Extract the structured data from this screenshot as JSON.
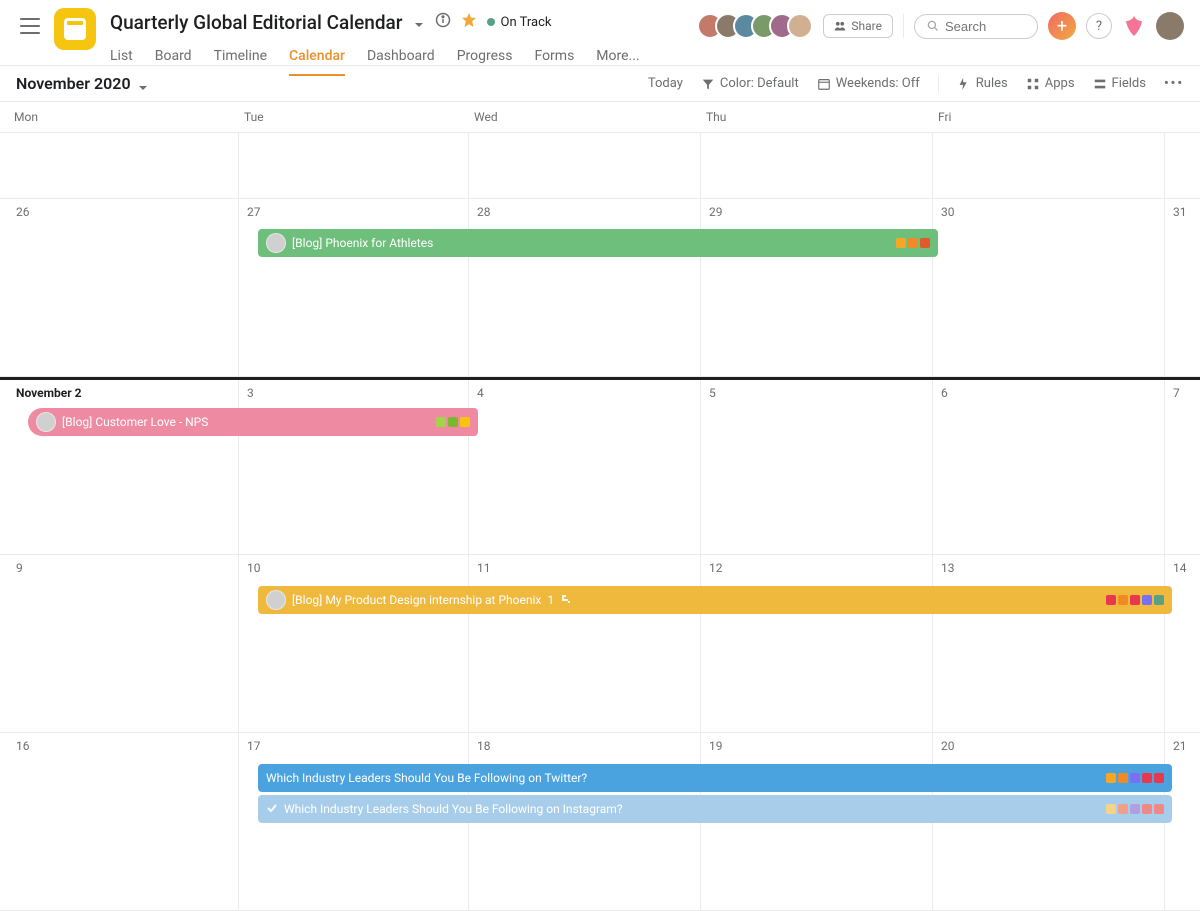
{
  "header": {
    "project_title": "Quarterly Global Editorial Calendar",
    "status_label": "On Track",
    "share_label": "Share",
    "search_placeholder": "Search",
    "tabs": [
      "List",
      "Board",
      "Timeline",
      "Calendar",
      "Dashboard",
      "Progress",
      "Forms",
      "More..."
    ],
    "active_tab_index": 3
  },
  "toolbar": {
    "month_label": "November 2020",
    "today_label": "Today",
    "color_label": "Color: Default",
    "weekends_label": "Weekends: Off",
    "rules_label": "Rules",
    "apps_label": "Apps",
    "fields_label": "Fields"
  },
  "calendar": {
    "day_headers": [
      "Mon",
      "Tue",
      "Wed",
      "Thu",
      "Fri",
      ""
    ],
    "rows": [
      {
        "height": "short",
        "dates": [
          "",
          "",
          "",
          "",
          "",
          ""
        ]
      },
      {
        "height": "tall",
        "dates": [
          "26",
          "27",
          "28",
          "29",
          "30",
          "31"
        ]
      },
      {
        "height": "tall",
        "dates": [
          "November 2",
          "3",
          "4",
          "5",
          "6",
          "7"
        ],
        "today_col": 0
      },
      {
        "height": "tall",
        "dates": [
          "9",
          "10",
          "11",
          "12",
          "13",
          "14"
        ]
      },
      {
        "height": "tall",
        "dates": [
          "16",
          "17",
          "18",
          "19",
          "20",
          "21"
        ]
      }
    ]
  },
  "events": {
    "e1": {
      "title": "[Blog] Phoenix for Athletes",
      "tag_colors": [
        "#f5a623",
        "#f08a24",
        "#e05a2a"
      ]
    },
    "e2": {
      "title": "[Blog] Customer Love - NPS",
      "tag_colors": [
        "#a3d34b",
        "#7ab92f",
        "#f5c50f"
      ]
    },
    "e3": {
      "title": "[Blog] My Product Design internship at Phoenix",
      "count": "1",
      "tag_colors": [
        "#e8384f",
        "#f08a24",
        "#e8384f",
        "#7a6ff0",
        "#58a182"
      ]
    },
    "e4": {
      "title": "Which Industry Leaders Should You Be Following on Twitter?",
      "tag_colors": [
        "#f5a623",
        "#f08a24",
        "#7a6ff0",
        "#e8384f",
        "#e8384f"
      ]
    },
    "e5": {
      "title": "Which Industry Leaders Should You Be Following on Instagram?",
      "tag_colors": [
        "#f5d488",
        "#f0a088",
        "#b0a0e0",
        "#f08888",
        "#f08888"
      ]
    }
  }
}
